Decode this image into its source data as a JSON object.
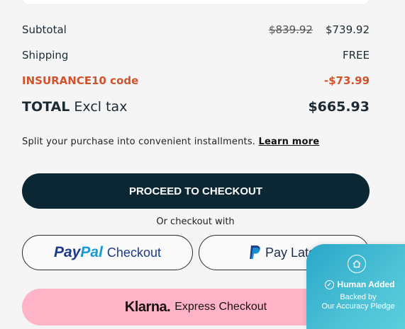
{
  "summary": {
    "subtotal_label": "Subtotal",
    "subtotal_old": "$839.92",
    "subtotal_new": "$739.92",
    "shipping_label": "Shipping",
    "shipping_value": "FREE",
    "code_label": "INSURANCE10 code",
    "code_value": "-$73.99",
    "total_label": "TOTAL",
    "total_suffix": "Excl tax",
    "total_value": "$665.93"
  },
  "installments": {
    "text": "Split your purchase into convenient installments.",
    "link": "Learn more"
  },
  "checkout": {
    "proceed_label": "PROCEED TO CHECKOUT",
    "or_text": "Or checkout with",
    "paypal_pay": "Pay",
    "paypal_pal": "Pal",
    "paypal_checkout": "Checkout",
    "paylater_label": "Pay Later",
    "klarna_logo": "Klarna.",
    "klarna_label": "Express Checkout"
  },
  "badge": {
    "title": "Human Added",
    "line1": "Backed by",
    "line2": "Our Accuracy Pledge"
  },
  "colors": {
    "discount": "#d0532b",
    "primary_button": "#0b2733",
    "klarna_pink": "#ffb3c7",
    "paypal_dark_blue": "#1b3a8c",
    "paypal_light_blue": "#179bd7",
    "badge_teal": "#3bb6d0"
  },
  "icons": {
    "paypal_p": "paypal-p-icon",
    "home": "home-icon",
    "check": "check-circle-icon"
  }
}
